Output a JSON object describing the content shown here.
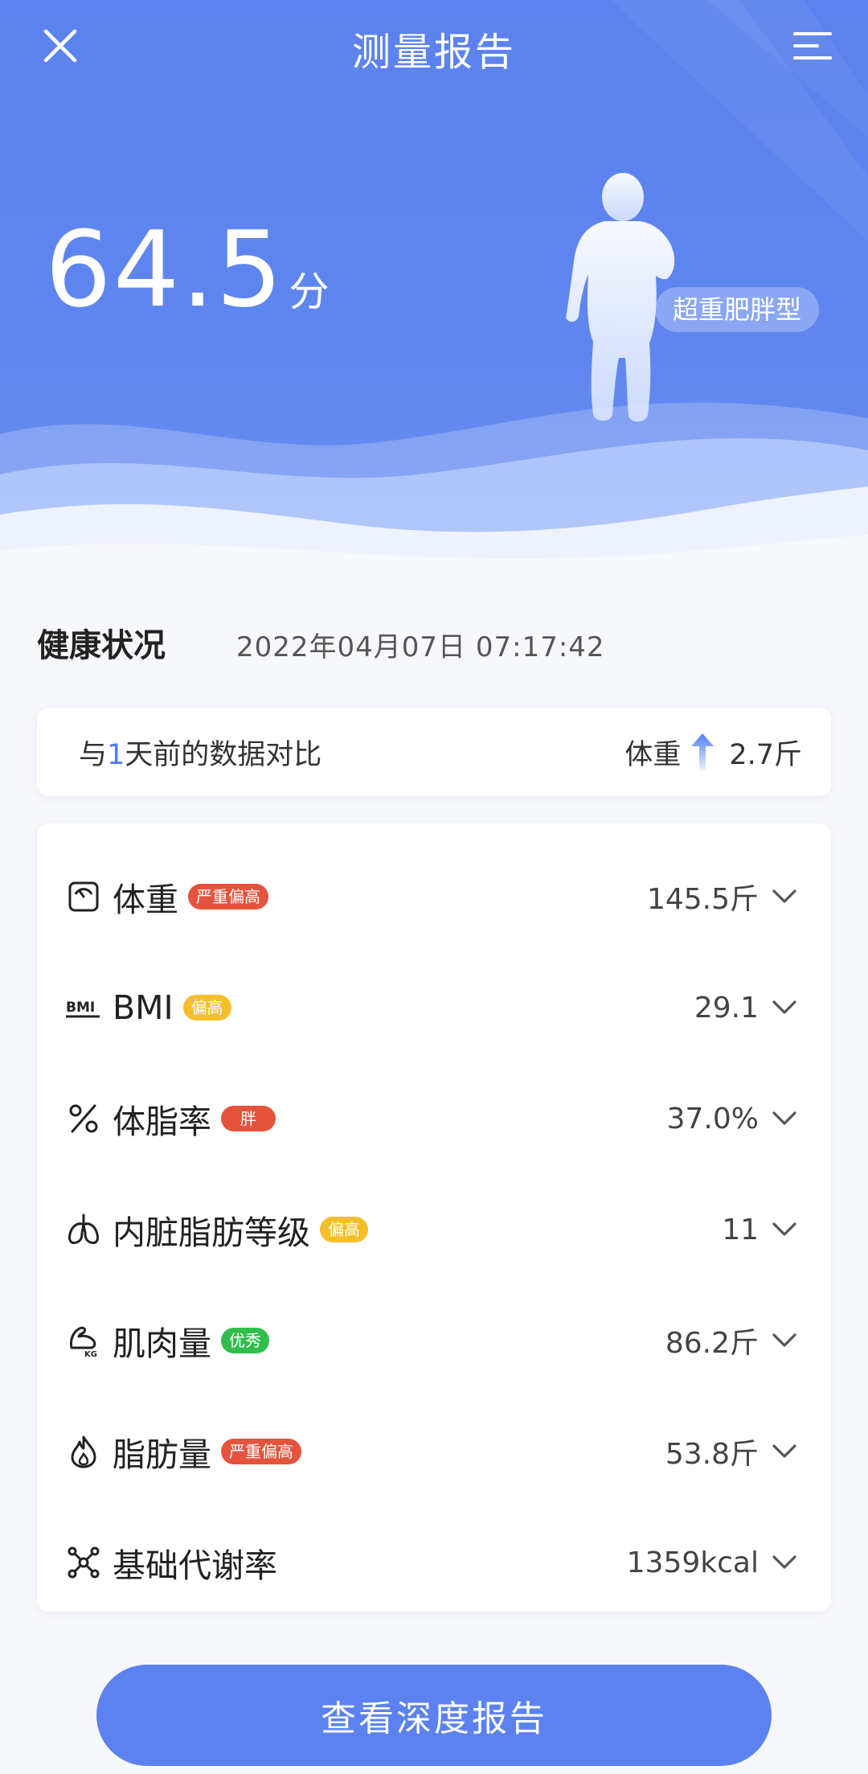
{
  "header": {
    "title": "测量报告",
    "score": "64.5",
    "score_unit": "分",
    "body_type": "超重肥胖型"
  },
  "status": {
    "title": "健康状况",
    "datetime": "2022年04月07日 07:17:42"
  },
  "compare": {
    "prefix": "与",
    "days": "1",
    "suffix": "天前的数据对比",
    "metric": "体重",
    "delta": "2.7斤",
    "direction": "up"
  },
  "metrics": [
    {
      "name": "体重",
      "badge": "严重偏高",
      "badge_color": "#e5533d",
      "value": "145.5斤",
      "icon": "scale-icon"
    },
    {
      "name": "BMI",
      "badge": "偏高",
      "badge_color": "#f5bf2c",
      "value": "29.1",
      "icon": "bmi-icon"
    },
    {
      "name": "体脂率",
      "badge": "胖",
      "badge_color": "#e5533d",
      "value": "37.0%",
      "icon": "percent-icon"
    },
    {
      "name": "内脏脂肪等级",
      "badge": "偏高",
      "badge_color": "#f5bf2c",
      "value": "11",
      "icon": "lungs-icon"
    },
    {
      "name": "肌肉量",
      "badge": "优秀",
      "badge_color": "#2fbf4a",
      "value": "86.2斤",
      "icon": "muscle-icon"
    },
    {
      "name": "脂肪量",
      "badge": "严重偏高",
      "badge_color": "#e5533d",
      "value": "53.8斤",
      "icon": "flame-icon"
    },
    {
      "name": "基础代谢率",
      "badge": "",
      "badge_color": "",
      "value": "1359kcal",
      "icon": "molecule-icon"
    }
  ],
  "button": {
    "label": "查看深度报告"
  },
  "colors": {
    "primary": "#5b82ee",
    "accent": "#4f7cf0"
  }
}
